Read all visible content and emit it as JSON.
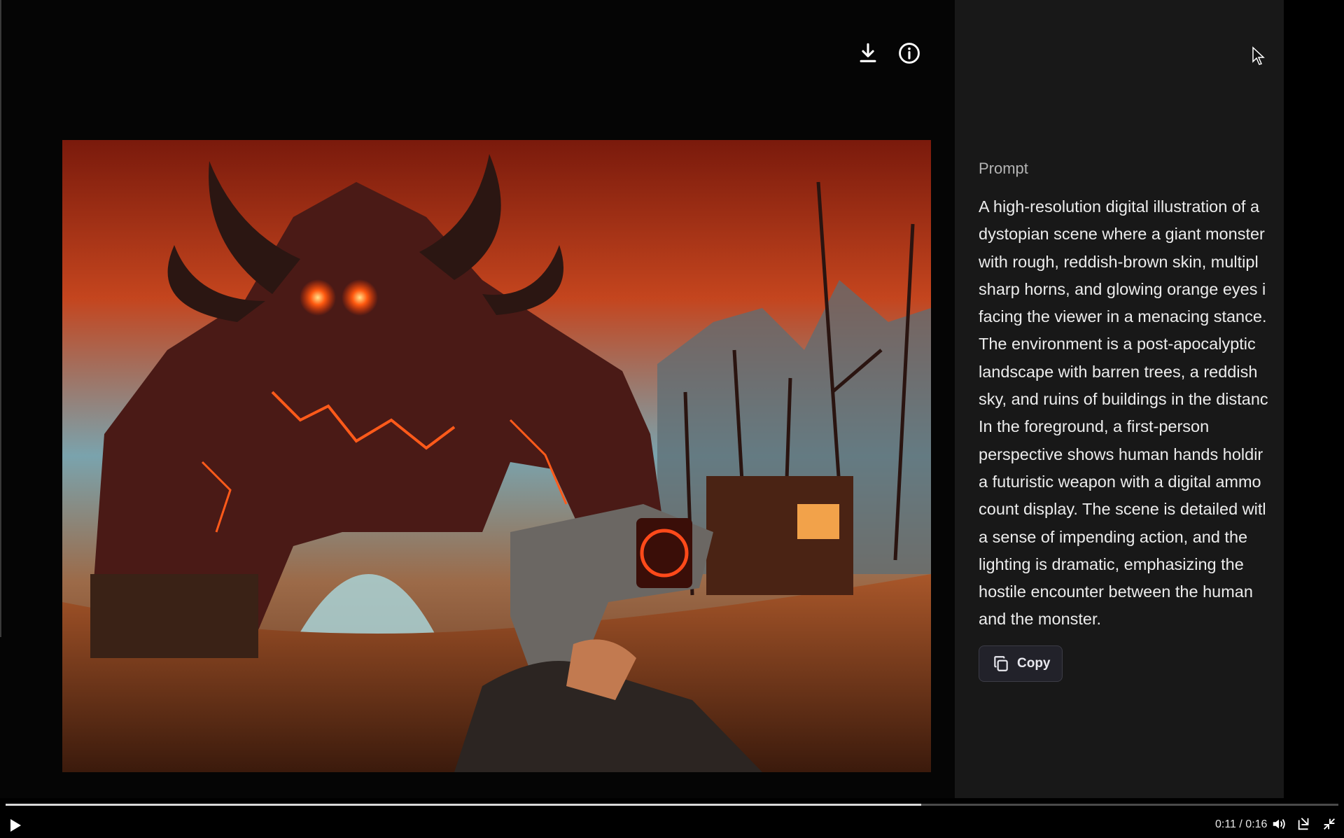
{
  "viewer": {
    "actions": {
      "download_icon": "download-icon",
      "info_icon": "info-icon"
    },
    "image": {
      "alt_icon": "generated-image"
    }
  },
  "prompt": {
    "label": "Prompt",
    "lines": [
      "A high-resolution digital illustration of a",
      "dystopian scene where a giant monster",
      "with rough, reddish-brown skin, multipl",
      "sharp horns, and glowing orange eyes i",
      "facing the viewer in a menacing stance.",
      "The environment is a post-apocalyptic",
      "landscape with barren trees, a reddish",
      "sky, and ruins of buildings in the distanc",
      "In the foreground, a first-person",
      "perspective shows human hands holdir",
      "a futuristic weapon with a digital ammo",
      "count display. The scene is detailed witl",
      "a sense of impending action, and the",
      "lighting is dramatic, emphasizing the",
      "hostile encounter between the human",
      "and the monster."
    ],
    "copy_label": "Copy"
  },
  "player": {
    "time": "0:11 / 0:16",
    "progress": 0.687
  },
  "colors": {
    "side_bg": "#181818",
    "accent_progress": "#d8d8d8"
  }
}
